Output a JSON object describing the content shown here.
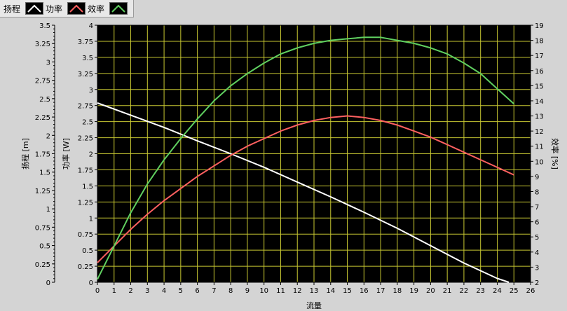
{
  "legend": [
    {
      "name": "扬程",
      "color": "#c8c8c8",
      "swatch_line": "none"
    },
    {
      "name": "功率",
      "color": "#ffffff",
      "swatch_line": "#ffffff"
    },
    {
      "name": "效率",
      "color": "#ff6060",
      "swatch_line": "#ff6060"
    },
    {
      "name": "",
      "color": "#60d060",
      "swatch_line": "#60d060"
    }
  ],
  "chart_data": {
    "type": "line",
    "xlabel": "流量",
    "xlim": [
      0,
      26
    ],
    "x_ticks": [
      "0",
      "1",
      "2",
      "3",
      "4",
      "5",
      "6",
      "7",
      "8",
      "9",
      "10",
      "11",
      "12",
      "13",
      "14",
      "15",
      "16",
      "17",
      "18",
      "19",
      "20",
      "21",
      "22",
      "23",
      "24",
      "25",
      "26"
    ],
    "axes": {
      "head": {
        "label": "扬程 [m]",
        "lim": [
          0,
          3.5
        ],
        "ticks": [
          "0",
          "0.25",
          "0.5",
          "0.75",
          "1",
          "1.25",
          "1.5",
          "1.75",
          "2",
          "2.25",
          "2.5",
          "2.75",
          "3",
          "3.25",
          "3.5"
        ]
      },
      "power": {
        "label": "功率 [W]",
        "lim": [
          0,
          4
        ],
        "ticks": [
          "0",
          "0.25",
          "0.5",
          "0.75",
          "1",
          "1.25",
          "1.5",
          "1.75",
          "2",
          "2.25",
          "2.5",
          "2.75",
          "3",
          "3.25",
          "3.5",
          "3.75",
          "4"
        ]
      },
      "efficiency": {
        "label": "效率 [%]",
        "lim": [
          2,
          19
        ],
        "ticks": [
          "2",
          "3",
          "4",
          "5",
          "6",
          "7",
          "8",
          "9",
          "10",
          "11",
          "12",
          "13",
          "14",
          "15",
          "16",
          "17",
          "18",
          "19"
        ]
      }
    },
    "background": "#000000",
    "grid": true,
    "grid_color": "#c8c832",
    "series": [
      {
        "color": "#ffffff",
        "axis": "power",
        "x": [
          0,
          2,
          4,
          6,
          8,
          10,
          12,
          14,
          16,
          18,
          20,
          22,
          24,
          24.7
        ],
        "y": [
          2.79,
          2.6,
          2.41,
          2.2,
          2.0,
          1.79,
          1.56,
          1.33,
          1.09,
          0.84,
          0.57,
          0.3,
          0.06,
          0
        ]
      },
      {
        "color": "#ff6060",
        "axis": "efficiency",
        "x": [
          0,
          1,
          2,
          3,
          4,
          5,
          6,
          7,
          8,
          9,
          10,
          11,
          12,
          13,
          14,
          15,
          16,
          17,
          18,
          19,
          20,
          21,
          22,
          23,
          24,
          25
        ],
        "y": [
          3.3,
          4.4,
          5.5,
          6.5,
          7.4,
          8.2,
          9.0,
          9.7,
          10.4,
          11.0,
          11.5,
          12.0,
          12.4,
          12.7,
          12.9,
          13.0,
          12.9,
          12.7,
          12.4,
          12.0,
          11.6,
          11.1,
          10.6,
          10.1,
          9.6,
          9.1
        ]
      },
      {
        "color": "#60d060",
        "axis": "efficiency",
        "x": [
          0,
          1,
          2,
          3,
          4,
          5,
          6,
          7,
          8,
          9,
          10,
          11,
          12,
          13,
          14,
          15,
          16,
          17,
          18,
          19,
          20,
          21,
          22,
          23,
          24,
          25
        ],
        "y": [
          2.2,
          4.4,
          6.6,
          8.5,
          10.1,
          11.5,
          12.8,
          14.0,
          15.0,
          15.8,
          16.5,
          17.1,
          17.5,
          17.8,
          18.0,
          18.1,
          18.2,
          18.2,
          18.0,
          17.8,
          17.5,
          17.1,
          16.5,
          15.8,
          14.8,
          13.8
        ]
      }
    ]
  }
}
